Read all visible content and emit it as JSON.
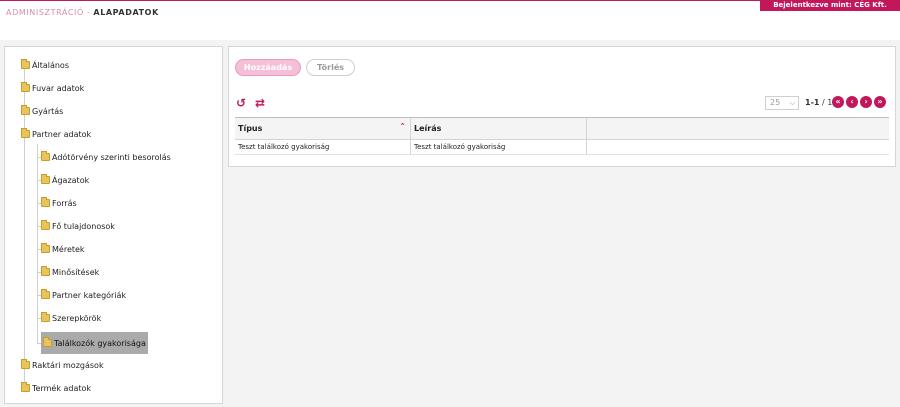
{
  "header": {
    "breadcrumb_parent": "ADMINISZTRÁCIÓ",
    "breadcrumb_sep": "-",
    "breadcrumb_current": "ALAPADATOK",
    "login_text": "Bejelentkezve mint: CÉG Kft.",
    "accent_color": "#c2185b"
  },
  "tree": {
    "items": [
      {
        "label": "Általános"
      },
      {
        "label": "Fuvar adatok"
      },
      {
        "label": "Gyártás"
      },
      {
        "label": "Partner adatok"
      },
      {
        "label": "Adótörvény szerinti besorolás"
      },
      {
        "label": "Ágazatok"
      },
      {
        "label": "Forrás"
      },
      {
        "label": "Fő tulajdonosok"
      },
      {
        "label": "Méretek"
      },
      {
        "label": "Minősítések"
      },
      {
        "label": "Partner kategóriák"
      },
      {
        "label": "Szerepkörök"
      },
      {
        "label": "Találkozók gyakorisága",
        "selected": true
      },
      {
        "label": "Raktári mozgások"
      },
      {
        "label": "Termék adatok"
      }
    ],
    "icon": "folder-icon"
  },
  "toolbar": {
    "add_label": "Hozzáadás",
    "delete_label": "Törlés",
    "refresh_icon": "refresh-icon",
    "swap_icon": "swap-icon"
  },
  "pager": {
    "page_size": "25",
    "range": "1-1",
    "total": " / 1",
    "first_icon": "first-page-icon",
    "prev_icon": "prev-page-icon",
    "next_icon": "next-page-icon",
    "last_icon": "last-page-icon"
  },
  "grid": {
    "columns": [
      "Típus",
      "Leírás",
      ""
    ],
    "rows": [
      [
        "Teszt találkozó gyakoriság",
        "Teszt találkozó gyakoriság",
        ""
      ]
    ]
  }
}
